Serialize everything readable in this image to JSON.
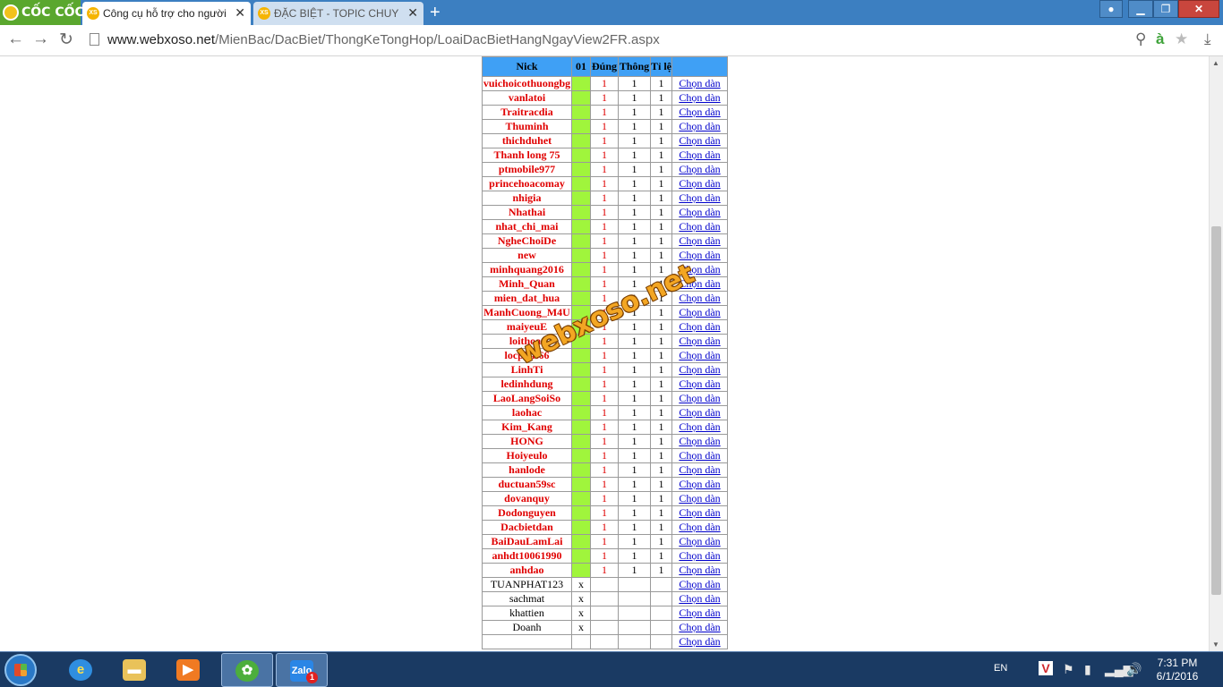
{
  "browser": {
    "brand": "CỐC CỐC",
    "tabs": [
      {
        "label": "Công cụ hỗ trợ cho người",
        "favicon": "XS",
        "active": true
      },
      {
        "label": "ĐẶC BIỆT - TOPIC CHUYÊN",
        "favicon": "XS",
        "active": false
      }
    ],
    "address": {
      "domain": "www.webxoso.net",
      "path": "/MienBac/DacBiet/ThongKeTongHop/LoaiDacBietHangNgayView2FR.aspx"
    }
  },
  "table": {
    "headers": {
      "nick": "Nick",
      "k01": "01",
      "dung": "Đúng",
      "thong": "Thông",
      "tile": "Tỉ lệ",
      "link": ""
    },
    "link_label": "Chọn dàn",
    "rows": [
      {
        "nick": "vuichoicothuongbg",
        "k01": "",
        "dung": "1",
        "thong": "1",
        "tile": "1"
      },
      {
        "nick": "vanlatoi",
        "k01": "",
        "dung": "1",
        "thong": "1",
        "tile": "1"
      },
      {
        "nick": "Traitracdia",
        "k01": "",
        "dung": "1",
        "thong": "1",
        "tile": "1"
      },
      {
        "nick": "Thuminh",
        "k01": "",
        "dung": "1",
        "thong": "1",
        "tile": "1"
      },
      {
        "nick": "thichduhet",
        "k01": "",
        "dung": "1",
        "thong": "1",
        "tile": "1"
      },
      {
        "nick": "Thanh long 75",
        "k01": "",
        "dung": "1",
        "thong": "1",
        "tile": "1"
      },
      {
        "nick": "ptmobile977",
        "k01": "",
        "dung": "1",
        "thong": "1",
        "tile": "1"
      },
      {
        "nick": "princehoacomay",
        "k01": "",
        "dung": "1",
        "thong": "1",
        "tile": "1"
      },
      {
        "nick": "nhigia",
        "k01": "",
        "dung": "1",
        "thong": "1",
        "tile": "1"
      },
      {
        "nick": "Nhathai",
        "k01": "",
        "dung": "1",
        "thong": "1",
        "tile": "1"
      },
      {
        "nick": "nhat_chi_mai",
        "k01": "",
        "dung": "1",
        "thong": "1",
        "tile": "1"
      },
      {
        "nick": "NgheChoiDe",
        "k01": "",
        "dung": "1",
        "thong": "1",
        "tile": "1"
      },
      {
        "nick": "new",
        "k01": "",
        "dung": "1",
        "thong": "1",
        "tile": "1"
      },
      {
        "nick": "minhquang2016",
        "k01": "",
        "dung": "1",
        "thong": "1",
        "tile": "1"
      },
      {
        "nick": "Minh_Quan",
        "k01": "",
        "dung": "1",
        "thong": "1",
        "tile": "1"
      },
      {
        "nick": "mien_dat_hua",
        "k01": "",
        "dung": "1",
        "thong": "1",
        "tile": "1"
      },
      {
        "nick": "ManhCuong_M4U",
        "k01": "",
        "dung": "1",
        "thong": "1",
        "tile": "1"
      },
      {
        "nick": "maiyeuE",
        "k01": "",
        "dung": "1",
        "thong": "1",
        "tile": "1"
      },
      {
        "nick": "loithoat",
        "k01": "",
        "dung": "1",
        "thong": "1",
        "tile": "1"
      },
      {
        "nick": "locphat66",
        "k01": "",
        "dung": "1",
        "thong": "1",
        "tile": "1"
      },
      {
        "nick": "LinhTi",
        "k01": "",
        "dung": "1",
        "thong": "1",
        "tile": "1"
      },
      {
        "nick": "ledinhdung",
        "k01": "",
        "dung": "1",
        "thong": "1",
        "tile": "1"
      },
      {
        "nick": "LaoLangSoiSo",
        "k01": "",
        "dung": "1",
        "thong": "1",
        "tile": "1"
      },
      {
        "nick": "laohac",
        "k01": "",
        "dung": "1",
        "thong": "1",
        "tile": "1"
      },
      {
        "nick": "Kim_Kang",
        "k01": "",
        "dung": "1",
        "thong": "1",
        "tile": "1"
      },
      {
        "nick": "HONG",
        "k01": "",
        "dung": "1",
        "thong": "1",
        "tile": "1"
      },
      {
        "nick": "Hoiyeulo",
        "k01": "",
        "dung": "1",
        "thong": "1",
        "tile": "1"
      },
      {
        "nick": "hanlode",
        "k01": "",
        "dung": "1",
        "thong": "1",
        "tile": "1"
      },
      {
        "nick": "ductuan59sc",
        "k01": "",
        "dung": "1",
        "thong": "1",
        "tile": "1"
      },
      {
        "nick": "dovanquy",
        "k01": "",
        "dung": "1",
        "thong": "1",
        "tile": "1"
      },
      {
        "nick": "Dodonguyen",
        "k01": "",
        "dung": "1",
        "thong": "1",
        "tile": "1"
      },
      {
        "nick": "Dacbietdan",
        "k01": "",
        "dung": "1",
        "thong": "1",
        "tile": "1"
      },
      {
        "nick": "BaiDauLamLai",
        "k01": "",
        "dung": "1",
        "thong": "1",
        "tile": "1"
      },
      {
        "nick": "anhdt10061990",
        "k01": "",
        "dung": "1",
        "thong": "1",
        "tile": "1"
      },
      {
        "nick": "anhdao",
        "k01": "",
        "dung": "1",
        "thong": "1",
        "tile": "1"
      },
      {
        "nick": "TUANPHAT123",
        "k01": "x",
        "dung": "",
        "thong": "",
        "tile": ""
      },
      {
        "nick": "sachmat",
        "k01": "x",
        "dung": "",
        "thong": "",
        "tile": ""
      },
      {
        "nick": "khattien",
        "k01": "x",
        "dung": "",
        "thong": "",
        "tile": ""
      },
      {
        "nick": "Doanh",
        "k01": "x",
        "dung": "",
        "thong": "",
        "tile": ""
      },
      {
        "nick": "",
        "k01": "",
        "dung": "",
        "thong": "",
        "tile": ""
      }
    ]
  },
  "watermark": "webxoso.net",
  "taskbar": {
    "apps": [
      {
        "name": "internet-explorer",
        "glyph": "e"
      },
      {
        "name": "file-explorer",
        "glyph": "▬"
      },
      {
        "name": "media-player",
        "glyph": "▶"
      },
      {
        "name": "coccoc-browser",
        "glyph": "✿"
      },
      {
        "name": "zalo",
        "glyph": "Zalo",
        "badge": "1"
      }
    ],
    "language": "EN",
    "time": "7:31 PM",
    "date": "6/1/2016"
  },
  "colors": {
    "header_bg": "#3fa0f5",
    "dung_header_bg": "#ff1a1a",
    "hit_cell_bg": "#a0f53c",
    "nick_red": "#e00000",
    "link": "#0000cc"
  }
}
